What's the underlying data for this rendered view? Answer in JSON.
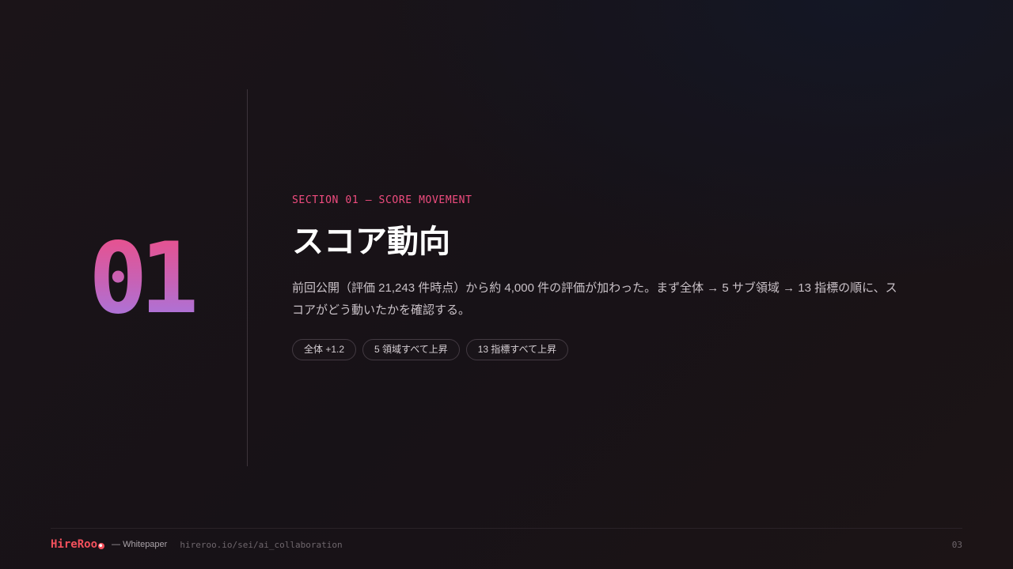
{
  "section": {
    "number": "01",
    "label": "SECTION 01 — SCORE MOVEMENT",
    "title": "スコア動向",
    "description": "前回公開（評価 21,243 件時点）から約 4,000 件の評価が加わった。まず全体 → 5 サブ領域 → 13 指標の順に、スコアがどう動いたかを確認する。",
    "tags": [
      "全体 +1.2",
      "5 領域すべて上昇",
      "13 指標すべて上昇"
    ]
  },
  "footer": {
    "logo": "HireRoo",
    "subtitle": "— Whitepaper",
    "url": "hireroo.io/sei/ai_collaboration",
    "page": "03"
  },
  "colors": {
    "accent": "#f04c7f",
    "number_gradient_top": "#ee4e86",
    "number_gradient_bottom": "#a17ae6",
    "logo": "#f4505c"
  },
  "icons": {
    "logo_mark": "circle-dot-icon"
  }
}
